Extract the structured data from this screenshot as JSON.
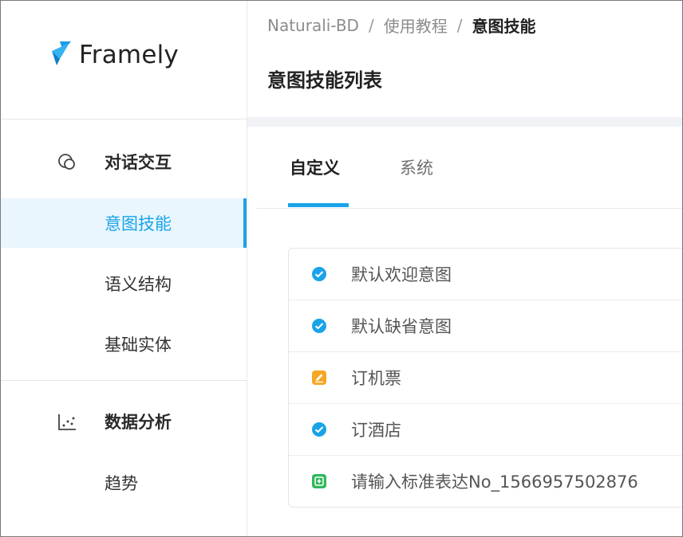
{
  "brand": {
    "name": "Framely"
  },
  "breadcrumb": [
    "Naturali-BD",
    "使用教程",
    "意图技能"
  ],
  "page": {
    "title": "意图技能列表"
  },
  "sidebar": {
    "groups": [
      {
        "title": "对话交互",
        "icon": "chat-icon",
        "items": [
          {
            "label": "意图技能",
            "active": true
          },
          {
            "label": "语义结构",
            "active": false
          },
          {
            "label": "基础实体",
            "active": false
          }
        ]
      },
      {
        "title": "数据分析",
        "icon": "scatter-chart-icon",
        "items": [
          {
            "label": "趋势",
            "active": false
          }
        ]
      }
    ]
  },
  "tabs": [
    {
      "label": "自定义",
      "active": true
    },
    {
      "label": "系统",
      "active": false
    }
  ],
  "intents": [
    {
      "label": "默认欢迎意图",
      "icon": "check-circle-icon",
      "status_color": "#1aa3e8"
    },
    {
      "label": "默认缺省意图",
      "icon": "check-circle-icon",
      "status_color": "#1aa3e8"
    },
    {
      "label": "订机票",
      "icon": "edit-icon",
      "status_color": "#f5a623"
    },
    {
      "label": "订酒店",
      "icon": "check-circle-icon",
      "status_color": "#1aa3e8"
    },
    {
      "label": "请输入标准表达No_1566957502876",
      "icon": "add-square-icon",
      "status_color": "#2fb85a"
    }
  ],
  "colors": {
    "accent": "#1aa3e8",
    "active_bg": "#e9f6fe"
  }
}
